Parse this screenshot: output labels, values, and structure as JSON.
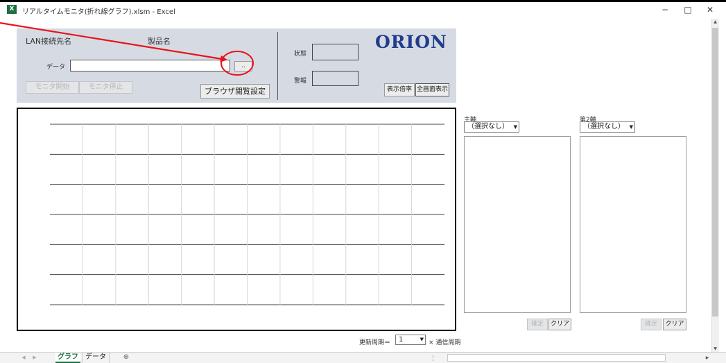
{
  "window": {
    "title": "リアルタイムモニタ(折れ線グラフ).xlsm - Excel",
    "app_icon": "excel-icon",
    "app_icon_text": "X",
    "controls": {
      "minimize": "−",
      "maximize": "□",
      "close": "✕"
    }
  },
  "panel": {
    "lan_label": "LAN接続先名",
    "product_label": "製品名",
    "data_label": "データ",
    "data_value": "",
    "browse_button": "..",
    "status_label": "状態",
    "alarm_label": "警報",
    "monitor_start": "モニタ開始",
    "monitor_stop": "モニタ停止",
    "browser_setting": "ブラウザ閲覧設定",
    "display_scale": "表示倍率",
    "fullscreen": "全画面表示",
    "logo": "ORION"
  },
  "chart_data": {
    "type": "line",
    "series": [],
    "title": "",
    "grid": true
  },
  "axes": {
    "primary_label": "主軸",
    "primary_select": "（選択なし）",
    "secondary_label": "第2軸",
    "secondary_select": "（選択なし）",
    "confirm_button": "確定",
    "clear_button": "クリア"
  },
  "update": {
    "label": "更新周期＝",
    "value": "1",
    "suffix": "× 通信周期"
  },
  "sheet_tabs": {
    "nav_prev": "◀",
    "nav_next": "▶",
    "tabs": [
      "グラフ",
      "データ"
    ],
    "active": "グラフ",
    "add": "⊕"
  },
  "colors": {
    "panel_bg": "#d6dbe3",
    "logo": "#1f3d8c",
    "annotation": "#e8131b"
  }
}
